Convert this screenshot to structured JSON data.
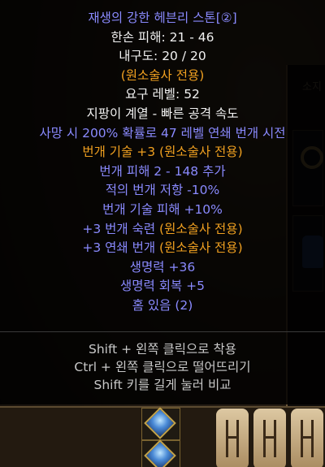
{
  "item": {
    "name": "재생의 강한 헤븐리 스톤[②]",
    "lines": [
      {
        "text": "한손 피해: 21 - 46",
        "color": "white"
      },
      {
        "text": "내구도: 20 / 20",
        "color": "white"
      },
      {
        "text": "(원소술사 전용)",
        "color": "orange"
      },
      {
        "text": "요구 레벨: 52",
        "color": "white"
      },
      {
        "text": "지팡이 계열 - 빠른 공격 속도",
        "color": "white"
      },
      {
        "text": "사망 시 200% 확률로 47 레벨 연쇄 번개 시전",
        "color": "blue"
      },
      {
        "text": "번개 기술 +3 (원소술사 전용)",
        "color": "orange"
      },
      {
        "text": "번개 피해 2 - 148 추가",
        "color": "blue"
      },
      {
        "text": "적의 번개 저항 -10%",
        "color": "blue"
      },
      {
        "text": "번개 기술 피해 +10%",
        "color": "blue"
      },
      {
        "text": "+3 번개 숙련 (원소술사 전용)",
        "color": "mixed",
        "prefix": "+3 번개 숙련 ",
        "suffix": "(원소술사 전용)"
      },
      {
        "text": "+3 연쇄 번개 (원소술사 전용)",
        "color": "mixed",
        "prefix": "+3 연쇄 번개 ",
        "suffix": "(원소술사 전용)"
      },
      {
        "text": "생명력 +36",
        "color": "blue"
      },
      {
        "text": "생명력 회복 +5",
        "color": "blue"
      },
      {
        "text": "홈 있음 (2)",
        "color": "blue"
      }
    ]
  },
  "hints": [
    "Shift + 왼쪽 클릭으로 착용",
    "Ctrl + 왼쪽 클릭으로 떨어뜨리기",
    "Shift 키를 길게 눌러 비교"
  ],
  "background": {
    "inventory_label": "소지"
  },
  "colors": {
    "blue": "#8a8aff",
    "white": "#f1f1f1",
    "orange": "#f0a020",
    "hint": "#c8c8c8"
  }
}
